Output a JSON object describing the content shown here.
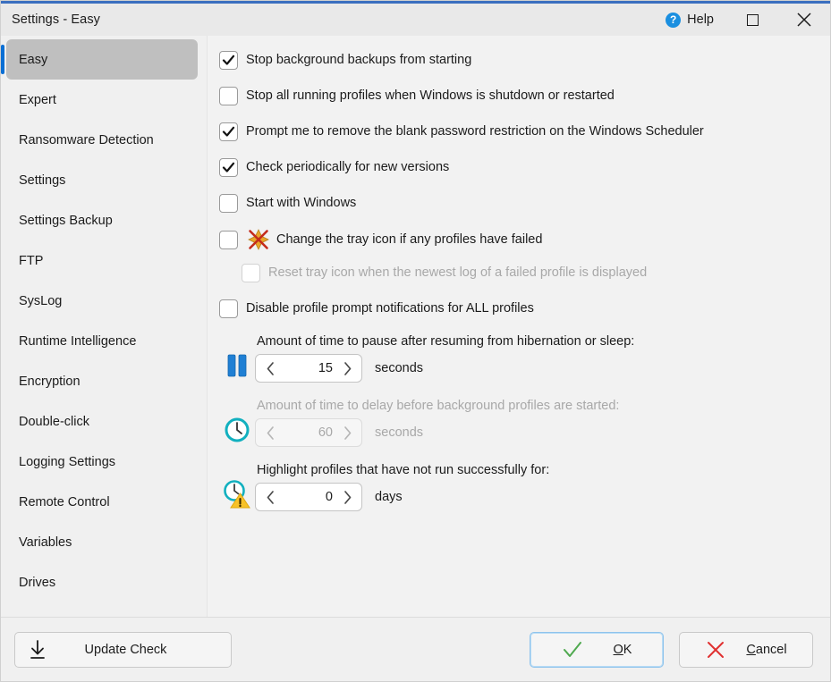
{
  "window": {
    "title": "Settings - Easy",
    "accent_color": "#3a6fbf",
    "titlebar_bg": "#e9e9e9"
  },
  "titlebar": {
    "help_label": "Help",
    "help_glyph": "?",
    "maximize_name": "maximize-button",
    "close_name": "close-button"
  },
  "sidebar": {
    "items": [
      {
        "label": "Easy",
        "active": true
      },
      {
        "label": "Expert",
        "active": false
      },
      {
        "label": "Ransomware Detection",
        "active": false
      },
      {
        "label": "Settings",
        "active": false
      },
      {
        "label": "Settings Backup",
        "active": false
      },
      {
        "label": "FTP",
        "active": false
      },
      {
        "label": "SysLog",
        "active": false
      },
      {
        "label": "Runtime Intelligence",
        "active": false
      },
      {
        "label": "Encryption",
        "active": false
      },
      {
        "label": "Double-click",
        "active": false
      },
      {
        "label": "Logging Settings",
        "active": false
      },
      {
        "label": "Remote Control",
        "active": false
      },
      {
        "label": "Variables",
        "active": false
      },
      {
        "label": "Drives",
        "active": false
      }
    ],
    "active_accent": "#0b6fd4",
    "active_bg": "#bfbfbf"
  },
  "main": {
    "checkboxes": [
      {
        "label": "Stop background backups from starting",
        "checked": true,
        "disabled": false,
        "indent": false,
        "icon": null
      },
      {
        "label": "Stop all running profiles when Windows is shutdown or restarted",
        "checked": false,
        "disabled": false,
        "indent": false,
        "icon": null
      },
      {
        "label": "Prompt me to remove the blank password restriction on the Windows Scheduler",
        "checked": true,
        "disabled": false,
        "indent": false,
        "icon": null
      },
      {
        "label": "Check periodically for new versions",
        "checked": true,
        "disabled": false,
        "indent": false,
        "icon": null
      },
      {
        "label": "Start with Windows",
        "checked": false,
        "disabled": false,
        "indent": false,
        "icon": null
      },
      {
        "label": "Change the tray icon if any profiles have failed",
        "checked": false,
        "disabled": false,
        "indent": false,
        "icon": "tray-failed-icon"
      },
      {
        "label": "Reset tray icon when the newest log of a failed profile is displayed",
        "checked": false,
        "disabled": true,
        "indent": true,
        "icon": null
      },
      {
        "label": "Disable profile prompt notifications for ALL profiles",
        "checked": false,
        "disabled": false,
        "indent": false,
        "icon": null
      }
    ],
    "spinners": [
      {
        "icon": "pause-icon",
        "caption": "Amount of time to pause after resuming from hibernation or sleep:",
        "value": "15",
        "unit": "seconds",
        "disabled": false
      },
      {
        "icon": "clock-icon",
        "caption": "Amount of time to delay before background profiles are started:",
        "value": "60",
        "unit": "seconds",
        "disabled": true
      },
      {
        "icon": "clock-warning-icon",
        "caption": "Highlight profiles that have not run successfully for:",
        "value": "0",
        "unit": "days",
        "disabled": false
      }
    ]
  },
  "footer": {
    "update_label": "Update Check",
    "ok_accel": "O",
    "ok_rest": "K",
    "cancel_accel": "C",
    "cancel_rest": "ancel"
  },
  "colors": {
    "pause_blue": "#1f7fd4",
    "clock_teal": "#12b0bf",
    "warn_yellow": "#f7c22a",
    "ok_green": "#4fa94f",
    "cancel_red": "#e03030",
    "tray_gold": "#e8a52a",
    "tray_x_red": "#c42b1c"
  }
}
